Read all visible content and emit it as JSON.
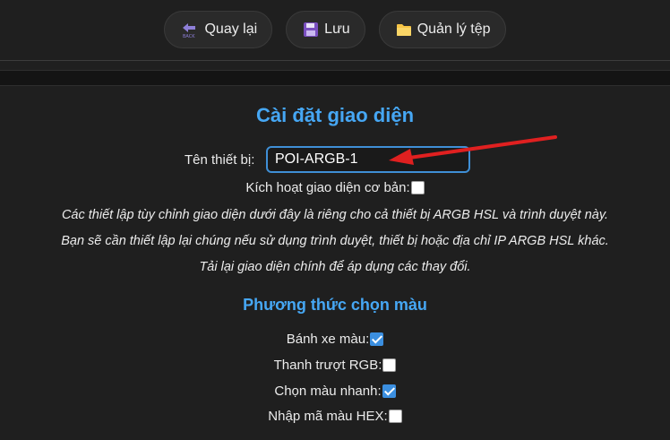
{
  "toolbar": {
    "back_label": "Quay lại",
    "back_icon": "back-arrow-icon",
    "save_label": "Lưu",
    "save_icon": "floppy-disk-icon",
    "files_label": "Quản lý tệp",
    "files_icon": "folder-icon"
  },
  "page": {
    "title": "Cài đặt giao diện",
    "device_name_label": "Tên thiết bị:",
    "device_name_value": "POI-ARGB-1",
    "basic_ui_label": "Kích hoạt giao diện cơ bản:",
    "basic_ui_checked": false,
    "notes": [
      "Các thiết lập tùy chỉnh giao diện dưới đây là riêng cho cả thiết bị ARGB HSL và trình duyệt này.",
      "Bạn sẽ cần thiết lập lại chúng nếu sử dụng trình duyệt, thiết bị hoặc địa chỉ IP ARGB HSL khác.",
      "Tải lại giao diện chính để áp dụng các thay đổi."
    ]
  },
  "color_picker": {
    "heading": "Phương thức chọn màu",
    "options": [
      {
        "label": "Bánh xe màu:",
        "checked": true
      },
      {
        "label": "Thanh trượt RGB:",
        "checked": false
      },
      {
        "label": "Chọn màu nhanh:",
        "checked": true
      },
      {
        "label": "Nhập mã màu HEX:",
        "checked": false
      }
    ]
  },
  "colors": {
    "accent": "#46a7f4",
    "annotation_arrow": "#e02020",
    "background": "#1f1f1f"
  }
}
